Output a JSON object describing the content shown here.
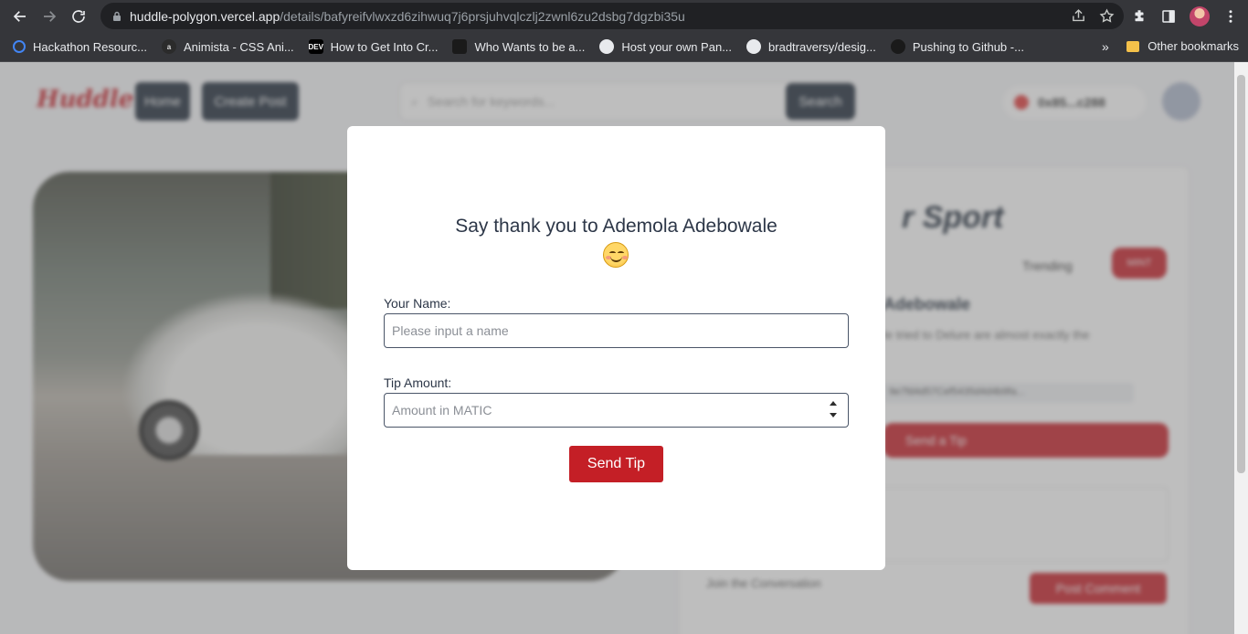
{
  "browser": {
    "url_host": "huddle-polygon.vercel.app",
    "url_path": "/details/bafyreifvlwxzd6zihwuq7j6prsjuhvqlczlj2zwnl6zu2dsbg7dgzbi35u",
    "bookmarks": [
      {
        "label": "Hackathon Resourc...",
        "icon": "globe-icon"
      },
      {
        "label": "Animista - CSS Ani...",
        "icon": "animista-icon"
      },
      {
        "label": "How to Get Into Cr...",
        "icon": "dev-icon",
        "badge": "DEV"
      },
      {
        "label": "Who Wants to be a...",
        "icon": "site-icon"
      },
      {
        "label": "Host your own Pan...",
        "icon": "globe-icon"
      },
      {
        "label": "bradtraversy/desig...",
        "icon": "github-icon"
      },
      {
        "label": "Pushing to Github -...",
        "icon": "site-icon"
      }
    ],
    "more_glyph": "»",
    "other_bookmarks": "Other bookmarks"
  },
  "page": {
    "logo": "Huddle",
    "nav": [
      "Home",
      "Create Post"
    ],
    "search_placeholder": "Search for keywords...",
    "search_button": "Search",
    "wallet": "0x85...c288",
    "card_title": "r Sport",
    "trending": "Trending",
    "red_pill": "MINT",
    "author": "Adebowale",
    "description": "le tried to Delure are almost exactly the",
    "address": "9e7fd4d57Cef5435d4d4b9fa...",
    "tip_bar": "Send a Tip",
    "join": "Join the Conversation",
    "post_comment": "Post Comment"
  },
  "modal": {
    "title": "Say thank you to Ademola Adebowale",
    "emoji": "smiling-face-icon",
    "name_label": "Your Name:",
    "name_placeholder": "Please input a name",
    "tip_label": "Tip Amount:",
    "tip_placeholder": "Amount in MATIC",
    "send_button": "Send Tip"
  },
  "colors": {
    "accent_red": "#c41f26",
    "navy": "#1f2b3a",
    "text": "#2d3748"
  }
}
